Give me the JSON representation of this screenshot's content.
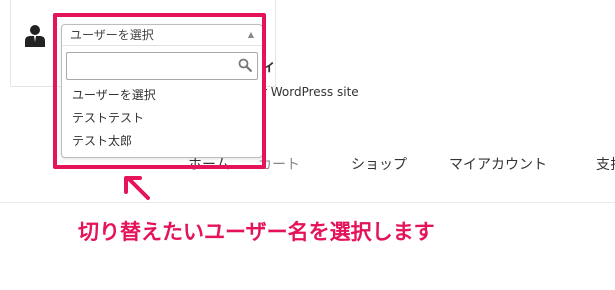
{
  "site": {
    "title_fragment": "ィ",
    "tagline_fragment": "r WordPress site"
  },
  "nav": {
    "items": [
      {
        "label": "ホーム"
      },
      {
        "label": "カート"
      },
      {
        "label": "ショップ"
      },
      {
        "label": "マイアカウント"
      },
      {
        "label": "支払"
      }
    ]
  },
  "user_switcher": {
    "selected": "ユーザーを選択",
    "search_value": "",
    "search_placeholder": "",
    "options": [
      {
        "label": "ユーザーを選択"
      },
      {
        "label": "テストテスト"
      },
      {
        "label": "テスト太郎"
      }
    ],
    "arrow_icon": "triangle-up-icon"
  },
  "annotation": {
    "callout": "切り替えたいユーザー名を選択します",
    "color": "#e5135b"
  }
}
